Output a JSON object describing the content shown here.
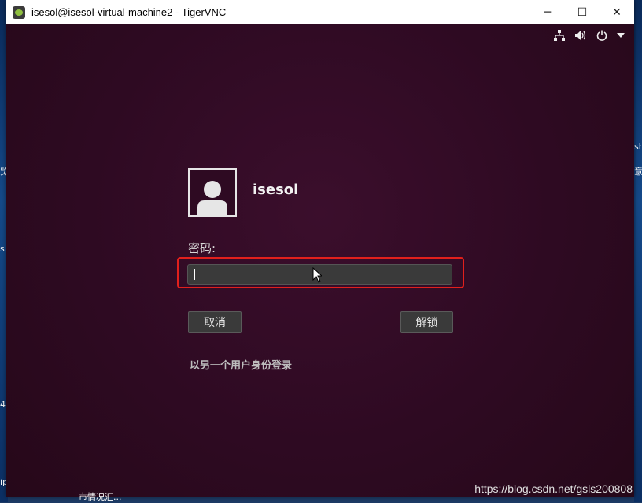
{
  "window": {
    "title": "isesol@isesol-virtual-machine2 - TigerVNC",
    "controls": {
      "minimize": "─",
      "maximize": "☐",
      "close": "✕"
    }
  },
  "desktop_fragments": {
    "left": [
      "览",
      "s.",
      "4",
      "ip"
    ],
    "right": [
      "sh",
      "意"
    ],
    "bottom": "市情况汇..."
  },
  "remote_topbar": {
    "icons": [
      "network-icon",
      "volume-icon",
      "power-icon",
      "chevron-down-icon"
    ]
  },
  "login": {
    "username": "isesol",
    "password_label": "密码:",
    "password_value": "",
    "cancel_label": "取消",
    "unlock_label": "解锁",
    "switch_user_label": "以另一个用户身份登录"
  },
  "watermark": "https://blog.csdn.net/gsls200808",
  "colors": {
    "background": "#2c0a1f",
    "highlight_border": "#e1201c",
    "field_bg": "#3a3a3a"
  }
}
